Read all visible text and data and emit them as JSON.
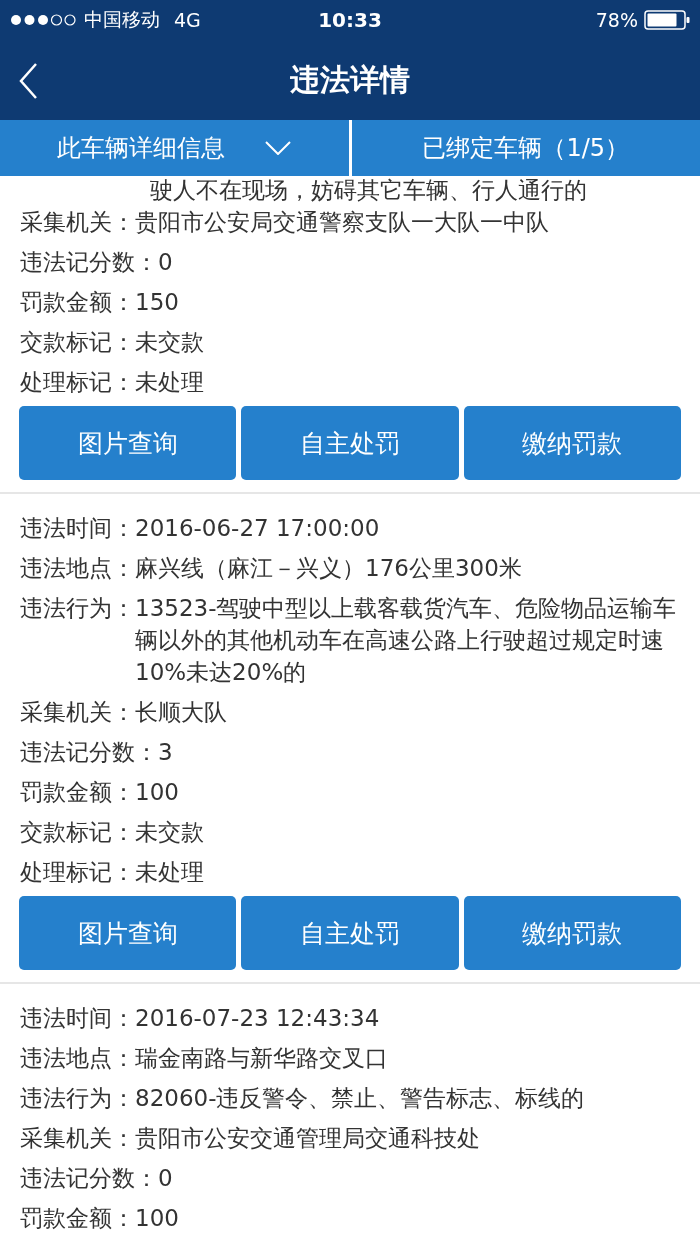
{
  "status_bar": {
    "carrier": "中国移动",
    "network": "4G",
    "time": "10:33",
    "battery": "78%"
  },
  "nav": {
    "title": "违法详情"
  },
  "tabs": [
    {
      "label": "此车辆详细信息",
      "kind": "dropdown"
    },
    {
      "label": "已绑定车辆（1/5）",
      "kind": "plain"
    }
  ],
  "records": [
    {
      "continued_text": "驶人不在现场，妨碍其它车辆、行人通行的",
      "fields": [
        {
          "label": "采集机关：",
          "value": "贵阳市公安局交通警察支队一大队一中队"
        },
        {
          "label": "违法记分数：",
          "value": "0"
        },
        {
          "label": "罚款金额：",
          "value": "150"
        },
        {
          "label": "交款标记：",
          "value": "未交款"
        },
        {
          "label": "处理标记：",
          "value": "未处理"
        }
      ],
      "buttons": [
        "图片查询",
        "自主处罚",
        "缴纳罚款"
      ]
    },
    {
      "fields": [
        {
          "label": "违法时间：",
          "value": "2016-06-27 17:00:00"
        },
        {
          "label": "违法地点：",
          "value": "麻兴线（麻江－兴义）176公里300米"
        },
        {
          "label": "违法行为：",
          "value": "13523-驾驶中型以上载客载货汽车、危险物品运输车辆以外的其他机动车在高速公路上行驶超过规定时速10%未达20%的"
        },
        {
          "label": "采集机关：",
          "value": "长顺大队"
        },
        {
          "label": "违法记分数：",
          "value": "3"
        },
        {
          "label": "罚款金额：",
          "value": "100"
        },
        {
          "label": "交款标记：",
          "value": "未交款"
        },
        {
          "label": "处理标记：",
          "value": "未处理"
        }
      ],
      "buttons": [
        "图片查询",
        "自主处罚",
        "缴纳罚款"
      ]
    },
    {
      "fields": [
        {
          "label": "违法时间：",
          "value": "2016-07-23 12:43:34"
        },
        {
          "label": "违法地点：",
          "value": "瑞金南路与新华路交叉口"
        },
        {
          "label": "违法行为：",
          "value": "82060-违反警令、禁止、警告标志、标线的"
        },
        {
          "label": "采集机关：",
          "value": "贵阳市公安交通管理局交通科技处"
        },
        {
          "label": "违法记分数：",
          "value": "0"
        },
        {
          "label": "罚款金额：",
          "value": "100"
        }
      ]
    }
  ]
}
